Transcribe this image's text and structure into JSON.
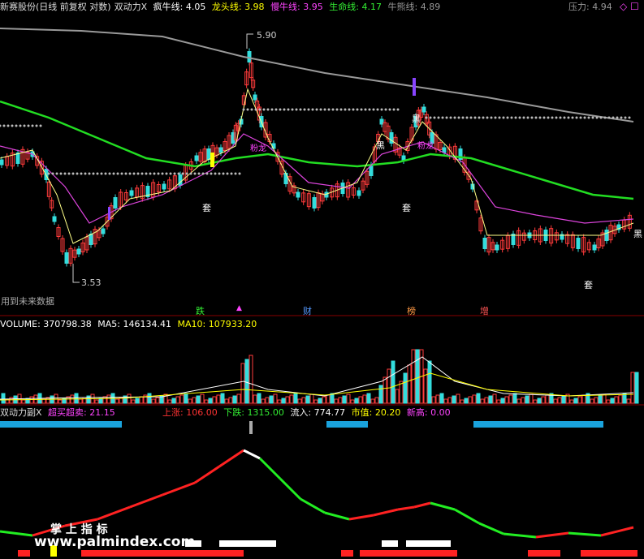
{
  "main": {
    "stock_name": "新赛股份(日线 前复权 对数)",
    "indicator_name": "双动力X",
    "lines": [
      {
        "label": "疯牛线:",
        "value": "4.05",
        "color": "#ffffff"
      },
      {
        "label": "龙头线:",
        "value": "3.98",
        "color": "#ffff00"
      },
      {
        "label": "慢牛线:",
        "value": "3.95",
        "color": "#ff44ff"
      },
      {
        "label": "生命线:",
        "value": "4.17",
        "color": "#33ee33"
      },
      {
        "label": "牛熊线:",
        "value": "4.89",
        "color": "#999999"
      },
      {
        "label": "压力:",
        "value": "4.94",
        "color": "#999999"
      }
    ],
    "max_price": "5.90",
    "min_price": "3.53",
    "future_data_note": "用到未来数据",
    "signals": {
      "tao": "套",
      "hei": "黑",
      "kai": "黑",
      "chuang": "粉龙"
    },
    "bottom_tags": [
      {
        "text": "跌",
        "color": "#33ee33"
      },
      {
        "text": "财",
        "color": "#5599ff"
      },
      {
        "text": "榜",
        "color": "#ff9944"
      },
      {
        "text": "增",
        "color": "#ff5555"
      }
    ],
    "colors": {
      "up": "#ff3b3b",
      "down": "#33dddd",
      "life": "#22dd22",
      "bull": "#999999"
    }
  },
  "volume": {
    "label": "VOLUME:",
    "value": "370798.38",
    "ma5_label": "MA5:",
    "ma5": "146134.41",
    "ma10_label": "MA10:",
    "ma10": "107933.20"
  },
  "sub": {
    "name": "双动力副X",
    "items": [
      {
        "label": "超买超卖:",
        "value": "21.15",
        "color": "#ff44ff"
      },
      {
        "label": "上涨:",
        "value": "106.00",
        "color": "#ff3333"
      },
      {
        "label": "下跌:",
        "value": "1315.00",
        "color": "#33ee33"
      },
      {
        "label": "流入:",
        "value": "774.77",
        "color": "#ffffff"
      },
      {
        "label": "市值:",
        "value": "20.20",
        "color": "#ffff00"
      },
      {
        "label": "新高:",
        "value": "0.00",
        "color": "#ff44ff"
      }
    ]
  },
  "watermark": {
    "title": "掌 上 指 标",
    "url": "www.palmindex.com"
  }
}
